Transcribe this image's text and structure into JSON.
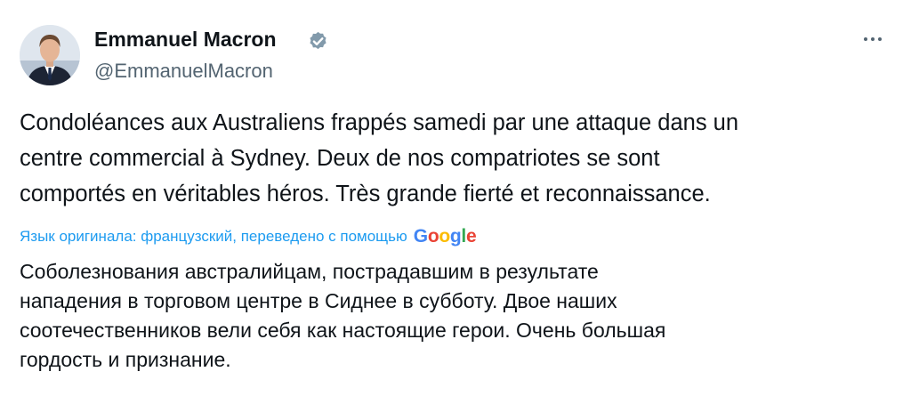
{
  "author": {
    "name": "Emmanuel Macron",
    "handle": "@EmmanuelMacron",
    "verified_icon": "verified-badge-icon",
    "verified_color": "#829aab"
  },
  "more_icon": "more-horizontal-icon",
  "tweet": {
    "lines": [
      "Condoléances aux Australiens frappés samedi par une attaque dans un",
      "centre commercial à Sydney. Deux de nos compatriotes se sont",
      "comportés en véritables héros. Très grande fierté et reconnaissance."
    ]
  },
  "translation": {
    "note": "Язык оригинала: французский, переведено с помощью",
    "provider_letters": [
      {
        "char": "G",
        "color": "#4285f4"
      },
      {
        "char": "o",
        "color": "#ea4335"
      },
      {
        "char": "o",
        "color": "#fbbc05"
      },
      {
        "char": "g",
        "color": "#4285f4"
      },
      {
        "char": "l",
        "color": "#34a853"
      },
      {
        "char": "e",
        "color": "#ea4335"
      }
    ],
    "lines": [
      "Соболезнования австралийцам, пострадавшим в результате",
      "нападения в торговом центре в Сиднее в субботу. Двое наших",
      "соотечественников вели себя как настоящие герои. Очень большая",
      "гордость и признание."
    ]
  },
  "colors": {
    "text": "#0f1419",
    "secondary": "#536471",
    "link": "#1d9bf0"
  }
}
